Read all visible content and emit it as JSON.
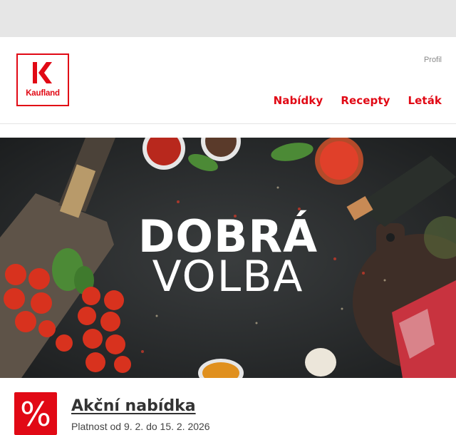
{
  "brand": {
    "name": "Kaufland",
    "color": "#e10915"
  },
  "header": {
    "profile_label": "Profil",
    "nav": [
      {
        "label": "Nabídky"
      },
      {
        "label": "Recepty"
      },
      {
        "label": "Leták"
      }
    ]
  },
  "hero": {
    "line1": "DOBRÁ",
    "line2": "VOLBA"
  },
  "offer": {
    "icon": "percent-icon",
    "icon_glyph": "%",
    "title": "Akční nabídka",
    "date": "Platnost od 9. 2. do 15. 2. 2026"
  }
}
